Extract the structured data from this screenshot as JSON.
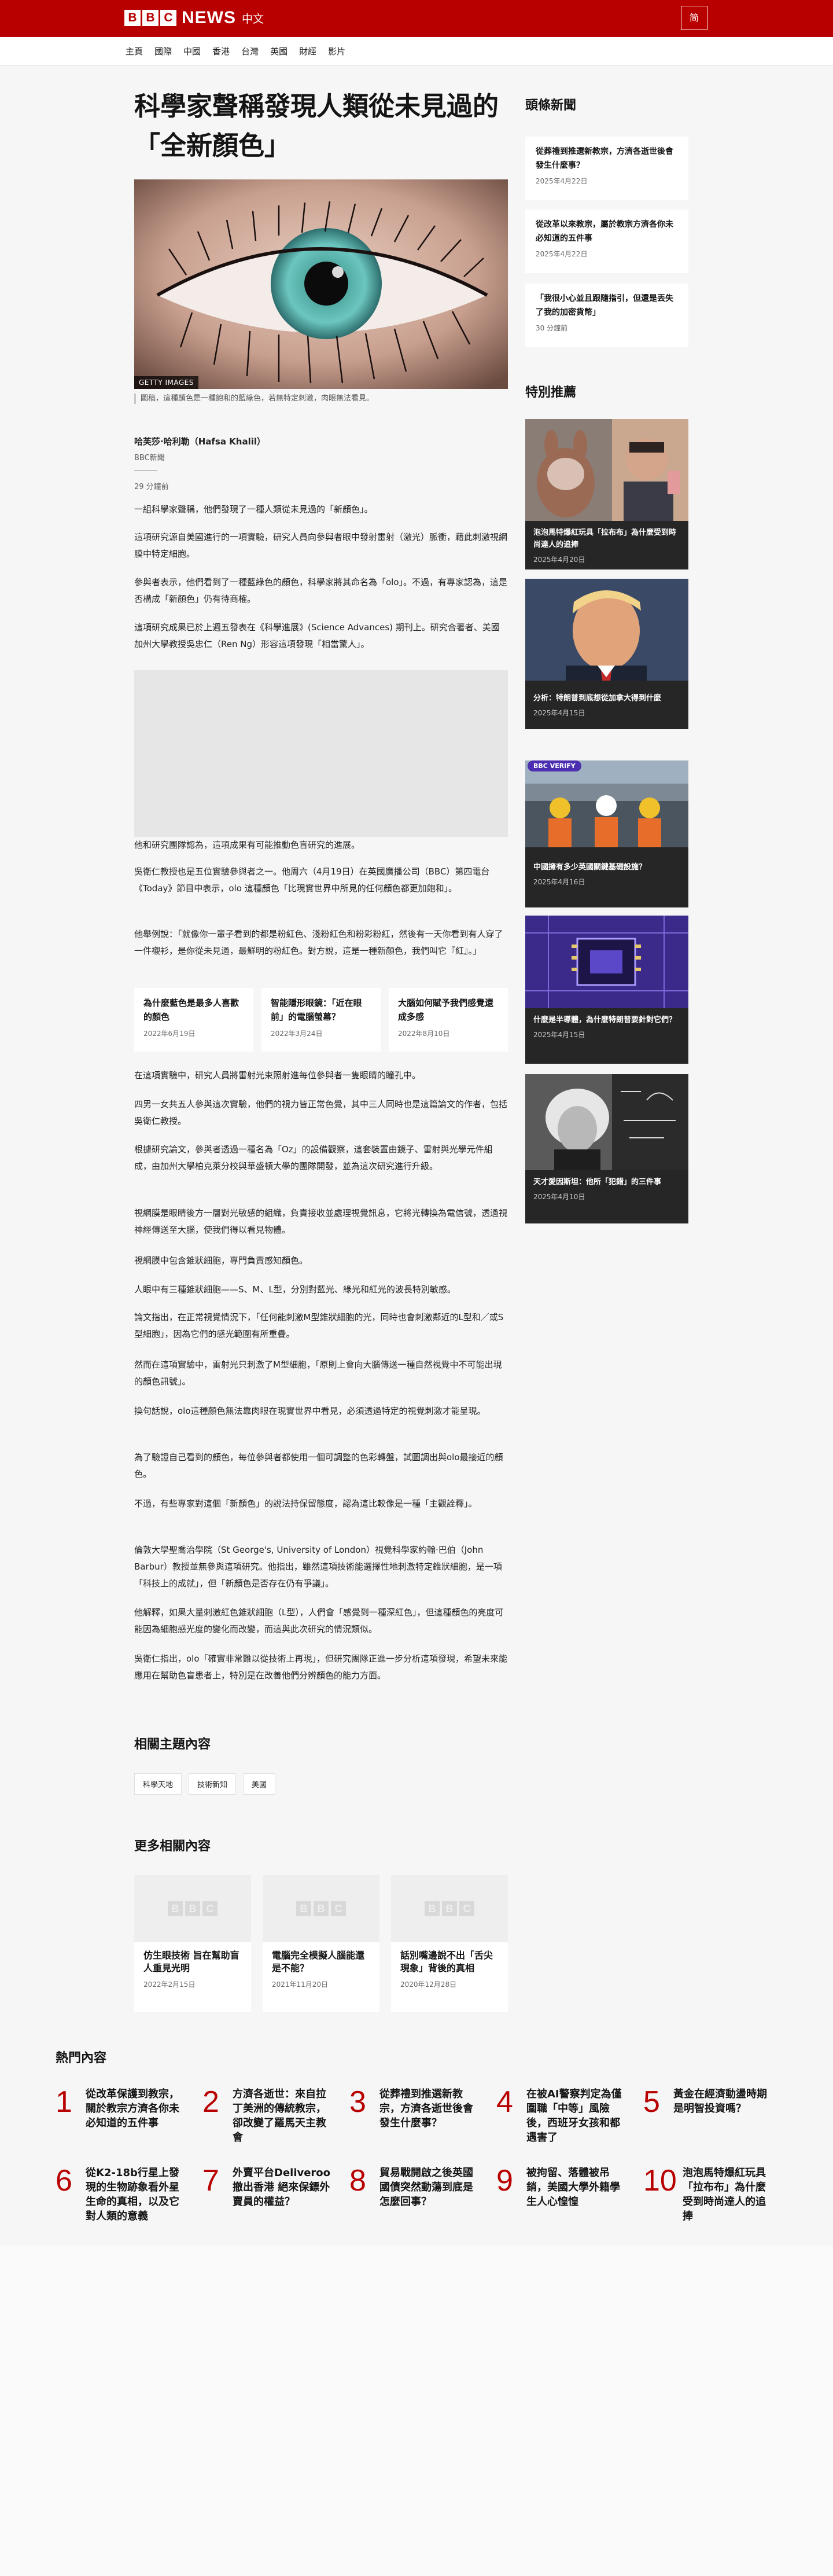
{
  "header": {
    "logo_letters": [
      "B",
      "B",
      "C"
    ],
    "logo_news": "NEWS",
    "logo_lang": "中文",
    "script_toggle": "简"
  },
  "nav": [
    "主頁",
    "國際",
    "中國",
    "香港",
    "台灣",
    "英國",
    "財經",
    "影片"
  ],
  "article": {
    "headline": "科學家聲稱發現人類從未見過的「全新顏色」",
    "image_credit": "GETTY IMAGES",
    "image_caption": "圖稿，這種顏色是一種飽和的藍綠色，若無特定刺激，肉眼無法看見。",
    "author": "哈芙莎·哈利勒（Hafsa Khalil）",
    "author_role": "BBC新聞",
    "time": "29 分鐘前",
    "paragraphs_a": [
      "一組科學家聲稱，他們發現了一種人類從未見過的「新顏色」。",
      "這項研究源自美國進行的一項實驗，研究人員向參與者眼中發射雷射（激光）脈衝，藉此刺激視網膜中特定細胞。",
      "參與者表示，他們看到了一種藍綠色的顏色，科學家將其命名為「olo」。不過，有專家認為，這是否構成「新顏色」仍有待商榷。",
      "這項研究成果已於上週五發表在《科學進展》(Science Advances) 期刊上。研究合著者、美國加州大學教授吳忠仁（Ren Ng）形容這項發現「相當驚人」。"
    ],
    "video_caption": "他和研究團隊認為，這項成果有可能推動色盲研究的進展。",
    "paragraphs_b": [
      "吳衛仁教授也是五位實驗參與者之一。他周六（4月19日）在英國廣播公司（BBC）第四電台《Today》節目中表示，olo 這種顏色「比現實世界中所見的任何顏色都更加飽和」。",
      "他舉例說：「就像你一輩子看到的都是粉紅色、淺粉紅色和粉彩粉紅，然後有一天你看到有人穿了一件襯衫，是你從未見過，最鮮明的粉紅色。對方說，這是一種新顏色，我們叫它『紅』。」"
    ],
    "related": [
      {
        "title": "為什麼藍色是最多人喜歡的顏色",
        "date": "2022年6月19日"
      },
      {
        "title": "智能隱形眼鏡：「近在眼前」的電腦螢幕？",
        "date": "2022年3月24日"
      },
      {
        "title": "大腦如何賦予我們感覺還成多感",
        "date": "2022年8月10日"
      }
    ],
    "paragraphs_c": [
      "在這項實驗中，研究人員將雷射光束照射進每位參與者一隻眼睛的瞳孔中。",
      "四男一女共五人參與這次實驗，他們的視力皆正常色覺，其中三人同時也是這篇論文的作者，包括吳衛仁教授。",
      "根據研究論文，參與者透過一種名為「Oz」的設備觀察，這套裝置由鏡子、雷射與光學元件組成，由加州大學柏克萊分校與華盛頓大學的團隊開發，並為這次研究進行升級。",
      "視網膜是眼睛後方一層對光敏感的組織，負責接收並處理視覺訊息，它將光轉換為電信號，透過視神經傳送至大腦，使我們得以看見物體。",
      "視網膜中包含錐狀細胞，專門負責感知顏色。",
      "人眼中有三種錐狀細胞——S、M、L型，分別對藍光、綠光和紅光的波長特別敏感。",
      "論文指出，在正常視覺情況下，「任何能刺激M型錐狀細胞的光，同時也會刺激鄰近的L型和／或S型細胞」，因為它們的感光範圍有所重疊。",
      "然而在這項實驗中，雷射光只刺激了M型細胞，「原則上會向大腦傳送一種自然視覺中不可能出現的顏色訊號」。",
      "換句話說，olo這種顏色無法靠肉眼在現實世界中看見，必須透過特定的視覺刺激才能呈現。",
      "為了驗證自己看到的顏色，每位參與者都使用一個可調整的色彩轉盤，試圖調出與olo最接近的顏色。",
      "不過，有些專家對這個「新顏色」的說法持保留態度，認為這比較像是一種「主觀詮釋」。",
      "倫敦大學聖喬治學院（St George's, University of London）視覺科學家約翰·巴伯（John Barbur）教授並無參與這項研究。他指出，雖然這項技術能選擇性地刺激特定錐狀細胞，是一項「科技上的成就」，但「新顏色是否存在仍有爭議」。",
      "他解釋，如果大量刺激紅色錐狀細胞（L型），人們會「感覺到一種深紅色」，但這種顏色的亮度可能因為細胞感光度的變化而改變，而這與此次研究的情況類似。",
      "吳衛仁指出，olo「確實非常難以從技術上再現」，但研究團隊正進一步分析這項發現，希望未來能應用在幫助色盲患者上，特別是在改善他們分辨顏色的能力方面。"
    ],
    "topics_heading": "相關主題內容",
    "topics": [
      "科學天地",
      "技術新知",
      "美國"
    ],
    "more_heading": "更多相關內容",
    "more": [
      {
        "title": "仿生眼技術 旨在幫助盲人重見光明",
        "date": "2022年2月15日"
      },
      {
        "title": "電腦完全模擬人腦能還是不能？",
        "date": "2021年11月20日"
      },
      {
        "title": "話別嘴邊說不出「舌尖現象」背後的真相",
        "date": "2020年12月28日"
      }
    ]
  },
  "sidebar": {
    "top_heading": "頭條新聞",
    "top_stories": [
      {
        "title": "從葬禮到推選新教宗，方濟各逝世後會發生什麼事？",
        "date": "2025年4月22日"
      },
      {
        "title": "從改革以來教宗，屬於教宗方濟各你未必知道的五件事",
        "date": "2025年4月22日"
      },
      {
        "title": "「我很小心並且跟隨指引，但還是丟失了我的加密貨幣」",
        "date": "30 分鐘前"
      }
    ],
    "features_heading": "特別推薦",
    "features": [
      {
        "title": "泡泡馬特爆紅玩具「拉布布」為什麼受到時尚達人的追捧",
        "date": "2025年4月20日"
      },
      {
        "title": "分析：特朗普到底想從加拿大得到什麼",
        "date": "2025年4月15日"
      },
      {
        "title": "中國擁有多少英國關鍵基礎設施？",
        "date": "2025年4月16日",
        "badge": "VERIFY"
      },
      {
        "title": "什麼是半導體，為什麼特朗普要針對它們？",
        "date": "2025年4月15日"
      },
      {
        "title": "天才愛因斯坦：他所「犯錯」的三件事",
        "date": "2025年4月10日"
      }
    ]
  },
  "most_read": {
    "heading": "熱門內容",
    "items": [
      {
        "n": "1",
        "title": "從改革保護到教宗，關於教宗方濟各你未必知道的五件事"
      },
      {
        "n": "2",
        "title": "方濟各逝世：來自拉丁美洲的傳統教宗，卻改變了羅馬天主教會"
      },
      {
        "n": "3",
        "title": "從葬禮到推選新教宗，方濟各逝世後會發生什麼事？"
      },
      {
        "n": "4",
        "title": "在被AI警察判定為僅圍職「中等」風險後，西班牙女孩和都遇害了"
      },
      {
        "n": "5",
        "title": "黃金在經濟動盪時期是明智投資嗎？"
      },
      {
        "n": "6",
        "title": "從K2-18b行星上發現的生物跡象看外星生命的真相，以及它對人類的意義"
      },
      {
        "n": "7",
        "title": "外賣平台Deliveroo撤出香港 絕來保鏢外賣員的權益？"
      },
      {
        "n": "8",
        "title": "貿易戰開啟之後英國國債突然動蕩到底是怎麼回事？"
      },
      {
        "n": "9",
        "title": "被拘留、落體被吊銷，美國大學外籍學生人心惶惶"
      },
      {
        "n": "10",
        "title": "泡泡馬特爆紅玩具「拉布布」為什麼受到時尚達人的追捧"
      }
    ]
  }
}
